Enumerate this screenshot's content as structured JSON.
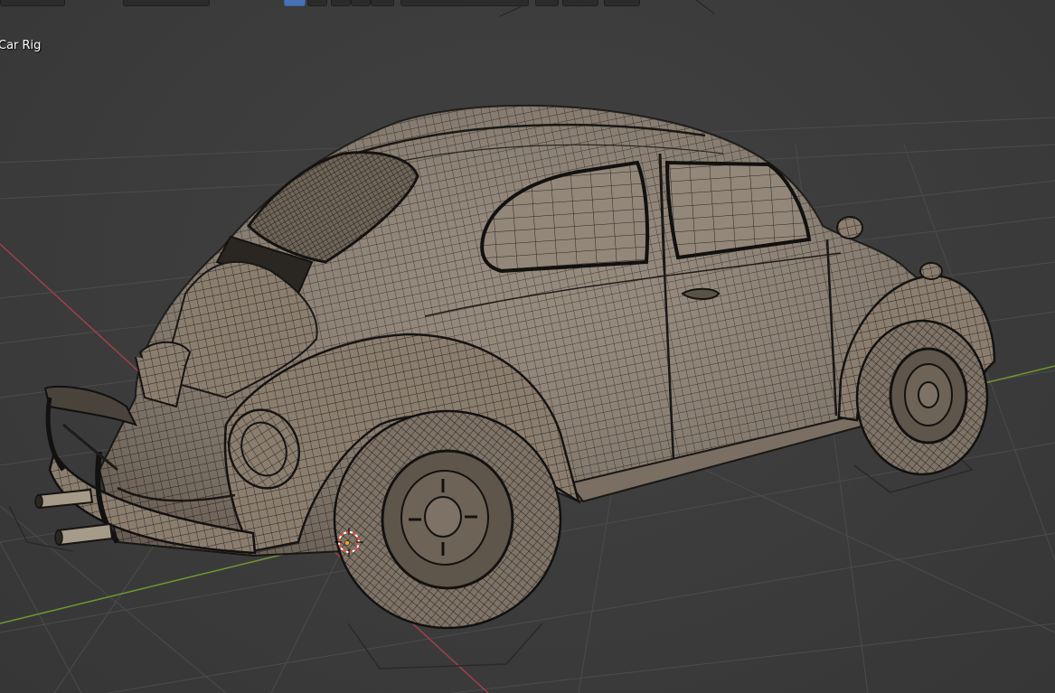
{
  "viewport": {
    "object_label": "Car Rig",
    "colors": {
      "background": "#3b3b3b",
      "grid": "#4a4a4a",
      "x_axis": "#a0414b",
      "y_axis": "#6f9a30",
      "mesh_fill": "#8f8272",
      "mesh_wire": "#262320",
      "header_widget": "#2b2b2b",
      "header_widget_active": "#4772b3",
      "cursor_ring": "#ff4040"
    }
  },
  "header": {
    "widgets": [
      {
        "icon": "mode-dropdown-icon"
      },
      {
        "icon": "pivot-dropdown-icon"
      },
      {
        "icon": "select-box-icon",
        "active": true
      },
      {
        "icon": "select-mode-icon"
      },
      {
        "icon": "snap-icon"
      },
      {
        "icon": "proportional-icon"
      },
      {
        "icon": "overlay-icon"
      },
      {
        "icon": "object-name-field-icon"
      },
      {
        "icon": "shading-icon"
      },
      {
        "icon": "viewport-options-icon"
      },
      {
        "icon": "camera-icon"
      }
    ]
  }
}
